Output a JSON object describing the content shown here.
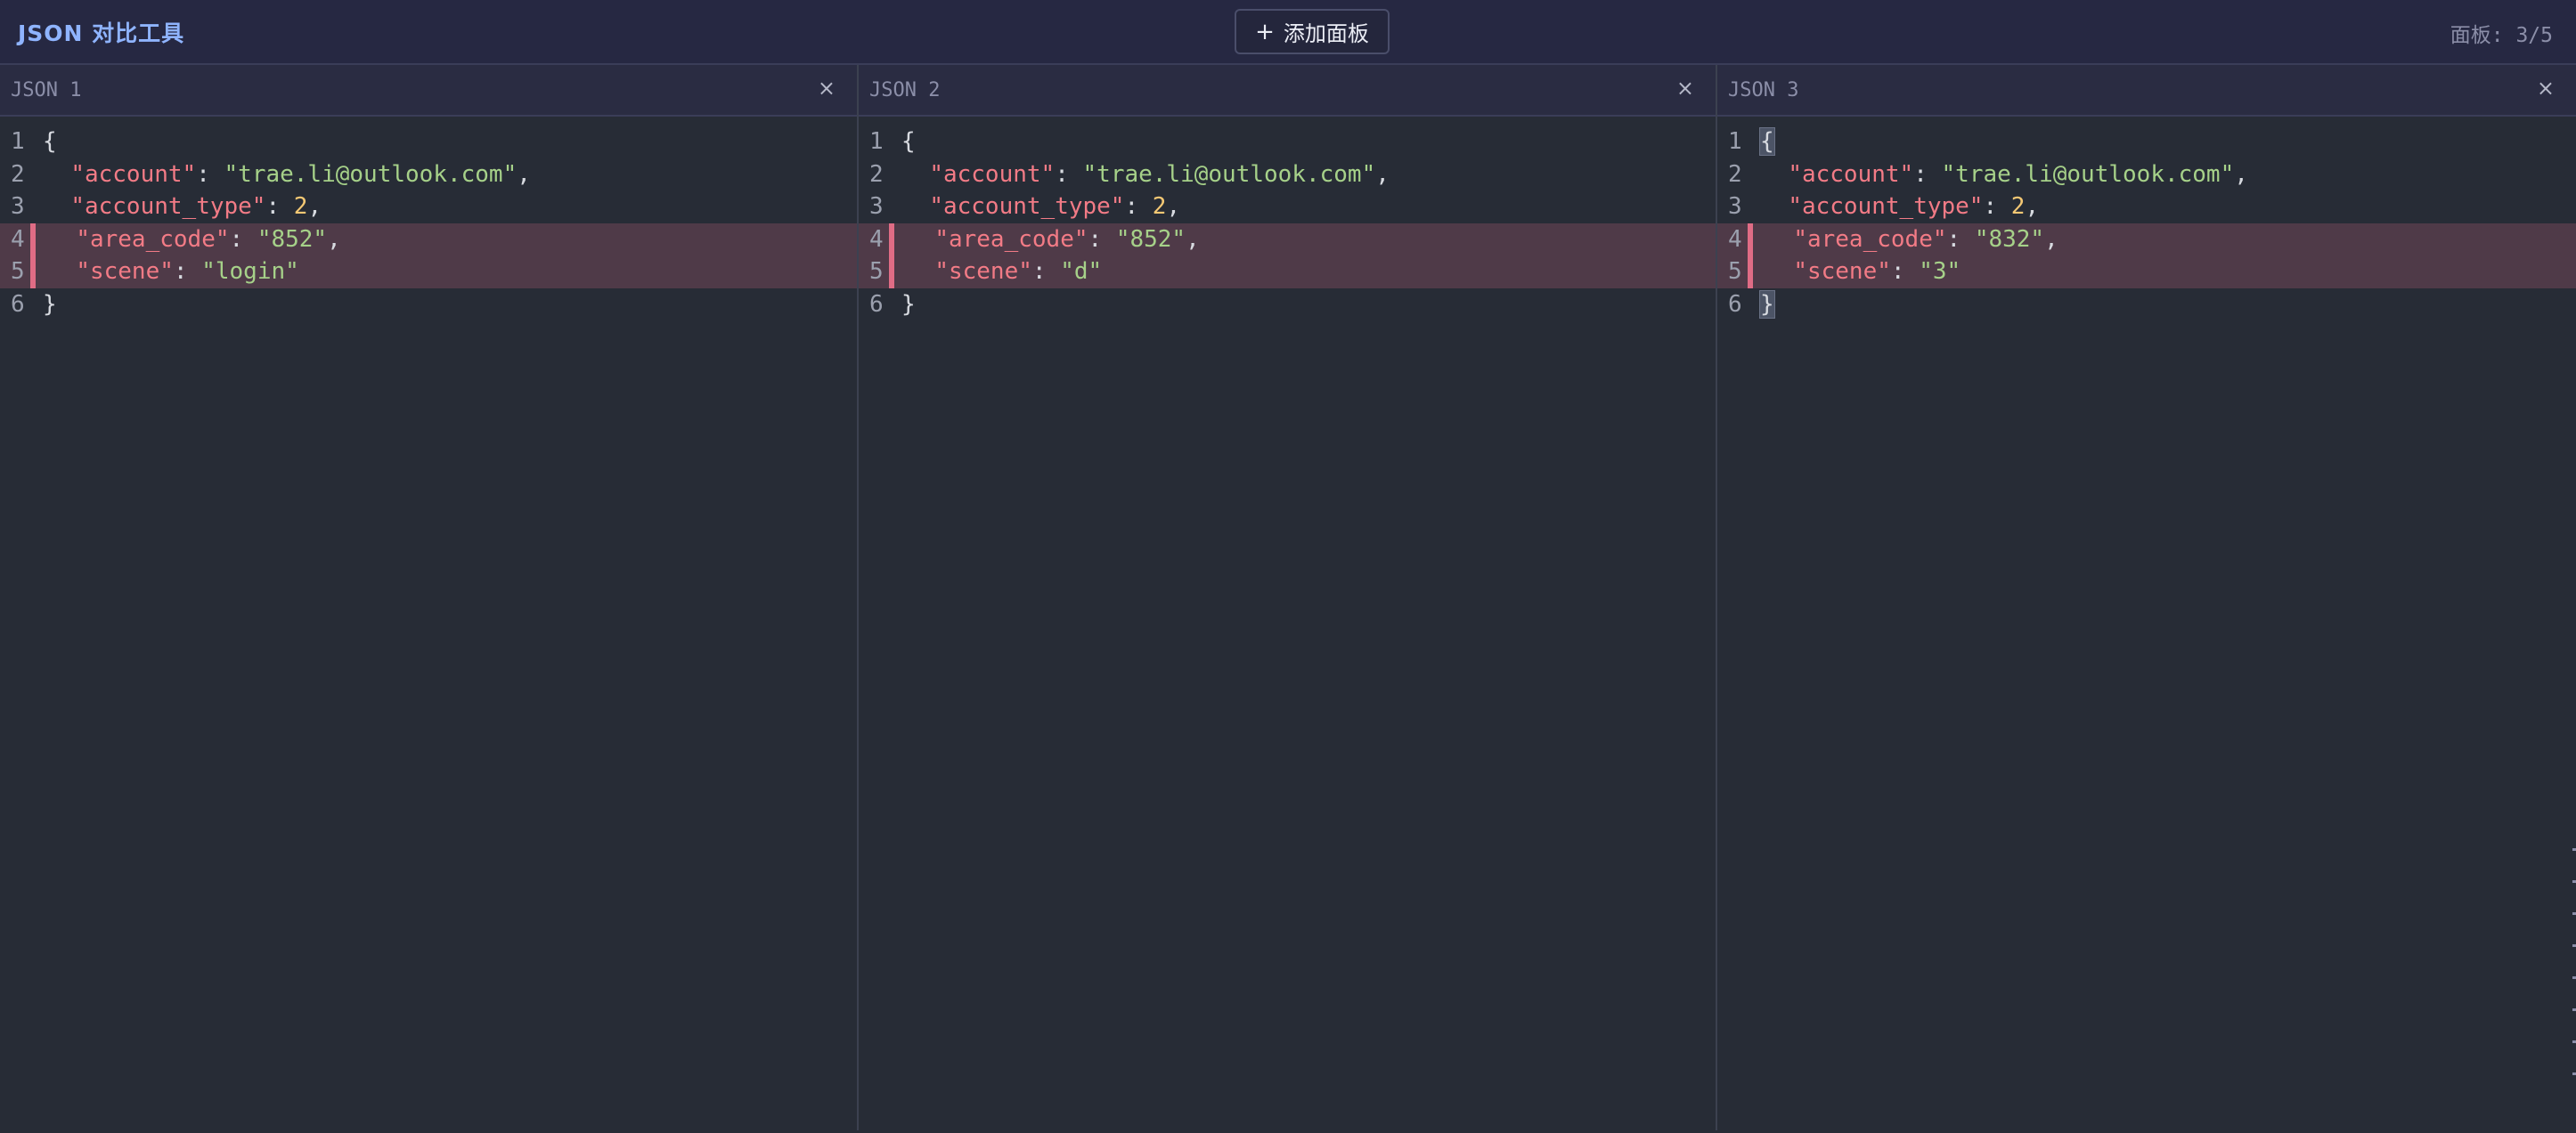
{
  "app": {
    "title": "JSON 对比工具",
    "add_panel_label": "添加面板",
    "panel_count": "面板: 3/5"
  },
  "icons": {
    "add": "plus-icon",
    "close": "close-icon"
  },
  "colors": {
    "accent": "#8fb4ff",
    "key": "#f27b86",
    "string": "#a6d189",
    "number": "#f4c874",
    "diff_bg": "#4f3a48",
    "diff_marker": "#e06c85"
  },
  "panels": [
    {
      "title": "JSON 1",
      "close_label": "×",
      "lines": [
        {
          "n": "1",
          "tokens": [
            {
              "t": "pun",
              "v": "{"
            }
          ]
        },
        {
          "n": "2",
          "tokens": [
            {
              "t": "pun",
              "v": "  "
            },
            {
              "t": "key",
              "v": "\"account\""
            },
            {
              "t": "pun",
              "v": ": "
            },
            {
              "t": "str",
              "v": "\"trae.li@outlook.com\""
            },
            {
              "t": "pun",
              "v": ","
            }
          ]
        },
        {
          "n": "3",
          "tokens": [
            {
              "t": "pun",
              "v": "  "
            },
            {
              "t": "key",
              "v": "\"account_type\""
            },
            {
              "t": "pun",
              "v": ": "
            },
            {
              "t": "num",
              "v": "2"
            },
            {
              "t": "pun",
              "v": ","
            }
          ]
        },
        {
          "n": "4",
          "diff": true,
          "tokens": [
            {
              "t": "pun",
              "v": "  "
            },
            {
              "t": "key",
              "v": "\"area_code\""
            },
            {
              "t": "pun",
              "v": ": "
            },
            {
              "t": "str",
              "v": "\"852\""
            },
            {
              "t": "pun",
              "v": ","
            }
          ]
        },
        {
          "n": "5",
          "diff": true,
          "tokens": [
            {
              "t": "pun",
              "v": "  "
            },
            {
              "t": "key",
              "v": "\"scene\""
            },
            {
              "t": "pun",
              "v": ": "
            },
            {
              "t": "str",
              "v": "\"login\""
            }
          ]
        },
        {
          "n": "6",
          "tokens": [
            {
              "t": "pun",
              "v": "}"
            }
          ]
        }
      ]
    },
    {
      "title": "JSON 2",
      "close_label": "×",
      "lines": [
        {
          "n": "1",
          "tokens": [
            {
              "t": "pun",
              "v": "{"
            }
          ]
        },
        {
          "n": "2",
          "tokens": [
            {
              "t": "pun",
              "v": "  "
            },
            {
              "t": "key",
              "v": "\"account\""
            },
            {
              "t": "pun",
              "v": ": "
            },
            {
              "t": "str",
              "v": "\"trae.li@outlook.com\""
            },
            {
              "t": "pun",
              "v": ","
            }
          ]
        },
        {
          "n": "3",
          "tokens": [
            {
              "t": "pun",
              "v": "  "
            },
            {
              "t": "key",
              "v": "\"account_type\""
            },
            {
              "t": "pun",
              "v": ": "
            },
            {
              "t": "num",
              "v": "2"
            },
            {
              "t": "pun",
              "v": ","
            }
          ]
        },
        {
          "n": "4",
          "diff": true,
          "tokens": [
            {
              "t": "pun",
              "v": "  "
            },
            {
              "t": "key",
              "v": "\"area_code\""
            },
            {
              "t": "pun",
              "v": ": "
            },
            {
              "t": "str",
              "v": "\"852\""
            },
            {
              "t": "pun",
              "v": ","
            }
          ]
        },
        {
          "n": "5",
          "diff": true,
          "tokens": [
            {
              "t": "pun",
              "v": "  "
            },
            {
              "t": "key",
              "v": "\"scene\""
            },
            {
              "t": "pun",
              "v": ": "
            },
            {
              "t": "str",
              "v": "\"d\""
            }
          ]
        },
        {
          "n": "6",
          "tokens": [
            {
              "t": "pun",
              "v": "}"
            }
          ]
        }
      ]
    },
    {
      "title": "JSON 3",
      "close_label": "×",
      "lines": [
        {
          "n": "1",
          "tokens": [
            {
              "t": "pun",
              "v": "{",
              "hl": true
            }
          ]
        },
        {
          "n": "2",
          "tokens": [
            {
              "t": "pun",
              "v": "  "
            },
            {
              "t": "key",
              "v": "\"account\""
            },
            {
              "t": "pun",
              "v": ": "
            },
            {
              "t": "str",
              "v": "\"trae.li@outlook.com\""
            },
            {
              "t": "pun",
              "v": ","
            }
          ]
        },
        {
          "n": "3",
          "tokens": [
            {
              "t": "pun",
              "v": "  "
            },
            {
              "t": "key",
              "v": "\"account_type\""
            },
            {
              "t": "pun",
              "v": ": "
            },
            {
              "t": "num",
              "v": "2"
            },
            {
              "t": "pun",
              "v": ","
            }
          ]
        },
        {
          "n": "4",
          "diff": true,
          "tokens": [
            {
              "t": "pun",
              "v": "  "
            },
            {
              "t": "key",
              "v": "\"area_code\""
            },
            {
              "t": "pun",
              "v": ": "
            },
            {
              "t": "str",
              "v": "\"832\""
            },
            {
              "t": "pun",
              "v": ","
            }
          ]
        },
        {
          "n": "5",
          "diff": true,
          "tokens": [
            {
              "t": "pun",
              "v": "  "
            },
            {
              "t": "key",
              "v": "\"scene\""
            },
            {
              "t": "pun",
              "v": ": "
            },
            {
              "t": "str",
              "v": "\"3\""
            }
          ]
        },
        {
          "n": "6",
          "tokens": [
            {
              "t": "pun",
              "v": "}",
              "hl": true
            }
          ]
        }
      ]
    }
  ]
}
